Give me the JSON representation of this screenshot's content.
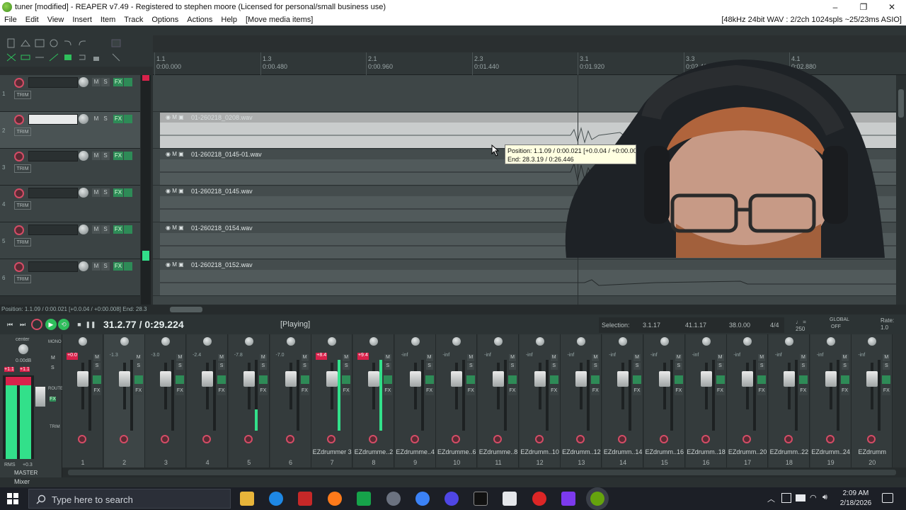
{
  "window": {
    "title": "tuner [modified] - REAPER v7.49 - Registered to stephen moore (Licensed for personal/small business use)",
    "controls": [
      "–",
      "❐",
      "✕"
    ]
  },
  "menu": {
    "items": [
      "File",
      "Edit",
      "View",
      "Insert",
      "Item",
      "Track",
      "Options",
      "Actions",
      "Help",
      "[Move media items]"
    ],
    "audio_status": "[48kHz 24bit WAV : 2/2ch 1024spls ~25/23ms ASIO]"
  },
  "ruler": {
    "bars": [
      "1.1",
      "1.3",
      "2.1",
      "2.3",
      "3.1",
      "3.3",
      "4.1"
    ],
    "times": [
      "0:00.000",
      "0:00.480",
      "0:00.960",
      "0:01.440",
      "0:01.920",
      "0:02.400",
      "0:02.880"
    ]
  },
  "tracks": [
    {
      "num": "1",
      "selected": false,
      "item": "",
      "trim_label": "TRIM"
    },
    {
      "num": "2",
      "selected": true,
      "item": "01-260218_0208.wav",
      "trim_label": "TRIM"
    },
    {
      "num": "3",
      "selected": false,
      "item": "01-260218_0145-01.wav",
      "trim_label": "TRIM"
    },
    {
      "num": "4",
      "selected": false,
      "item": "01-260218_0145.wav",
      "trim_label": "TRIM"
    },
    {
      "num": "5",
      "selected": false,
      "item": "01-260218_0154.wav",
      "trim_label": "TRIM"
    },
    {
      "num": "6",
      "selected": false,
      "item": "01-260218_0152.wav",
      "trim_label": "TRIM"
    }
  ],
  "tcp_buttons": {
    "mute": "M",
    "solo": "S",
    "fx": "FX"
  },
  "tooltip": {
    "line1": "Position: 1.1.09 / 0:00.021 [+0.0.04 / +0:00.008]",
    "line2": "End: 28.3.19 / 0:26.446"
  },
  "hscroll_status": "Position: 1.1.09 / 0:00.021 [+0.0.04 / +0:00.008] End: 28.3",
  "transport": {
    "time": "31.2.77 / 0:29.224",
    "state": "[Playing]",
    "selection_label": "Selection:",
    "sel_start": "3.1.17",
    "sel_end": "41.1.17",
    "sel_length": "38.0.00",
    "time_sig": "4/4",
    "bpm": "250",
    "global_label": "GLOBAL",
    "global_state": "OFF",
    "rate_label": "Rate:",
    "rate_value": "1.0"
  },
  "master": {
    "pan_label": "center",
    "vol": "0.00dB",
    "peak_l": "+1.1",
    "peak_r": "+1.1",
    "rms_label": "RMS",
    "rms_value": "+0.3",
    "name": "MASTER",
    "buttons": [
      "MONO",
      "M",
      "S",
      "ROUTE",
      "FX",
      "TRIM"
    ]
  },
  "strips": [
    {
      "num": "1",
      "name": "",
      "vol": "+0.0",
      "hot": true,
      "meter": 0
    },
    {
      "num": "2",
      "name": "",
      "vol": "-1.3",
      "hot": false,
      "meter": 0
    },
    {
      "num": "3",
      "name": "",
      "vol": "-3.0",
      "hot": false,
      "meter": 0
    },
    {
      "num": "4",
      "name": "",
      "vol": "-2.4",
      "hot": false,
      "meter": 0
    },
    {
      "num": "5",
      "name": "",
      "vol": "-7.8",
      "hot": false,
      "meter": 0.3
    },
    {
      "num": "6",
      "name": "",
      "vol": "-7.0",
      "hot": false,
      "meter": 0
    },
    {
      "num": "7",
      "name": "EZdrummer 3",
      "vol": "+8.4",
      "hot": true,
      "meter": 1.0
    },
    {
      "num": "8",
      "name": "EZdrumme..2",
      "vol": "+9.4",
      "hot": true,
      "meter": 1.0
    },
    {
      "num": "9",
      "name": "EZdrumme..4",
      "vol": "-inf",
      "hot": false,
      "meter": 0
    },
    {
      "num": "10",
      "name": "EZdrumme..6",
      "vol": "-inf",
      "hot": false,
      "meter": 0
    },
    {
      "num": "11",
      "name": "EZdrumme..8",
      "vol": "-inf",
      "hot": false,
      "meter": 0
    },
    {
      "num": "12",
      "name": "EZdrumm..10",
      "vol": "-inf",
      "hot": false,
      "meter": 0
    },
    {
      "num": "13",
      "name": "EZdrumm..12",
      "vol": "-inf",
      "hot": false,
      "meter": 0
    },
    {
      "num": "14",
      "name": "EZdrumm..14",
      "vol": "-inf",
      "hot": false,
      "meter": 0
    },
    {
      "num": "15",
      "name": "EZdrumm..16",
      "vol": "-inf",
      "hot": false,
      "meter": 0
    },
    {
      "num": "16",
      "name": "EZdrumm..18",
      "vol": "-inf",
      "hot": false,
      "meter": 0
    },
    {
      "num": "17",
      "name": "EZdrumm..20",
      "vol": "-inf",
      "hot": false,
      "meter": 0
    },
    {
      "num": "18",
      "name": "EZdrumm..22",
      "vol": "-inf",
      "hot": false,
      "meter": 0
    },
    {
      "num": "19",
      "name": "EZdrumm..24",
      "vol": "-inf",
      "hot": false,
      "meter": 0
    },
    {
      "num": "20",
      "name": "EZdrumm",
      "vol": "-inf",
      "hot": false,
      "meter": 0
    }
  ],
  "mixer_tab": "Mixer",
  "taskbar": {
    "search_placeholder": "Type here to search",
    "time": "2:09 AM",
    "date": "2/18/2026"
  },
  "colors": {
    "accent_green": "#32e08a",
    "record_red": "#d44c66",
    "hot_red": "#d8224b"
  }
}
